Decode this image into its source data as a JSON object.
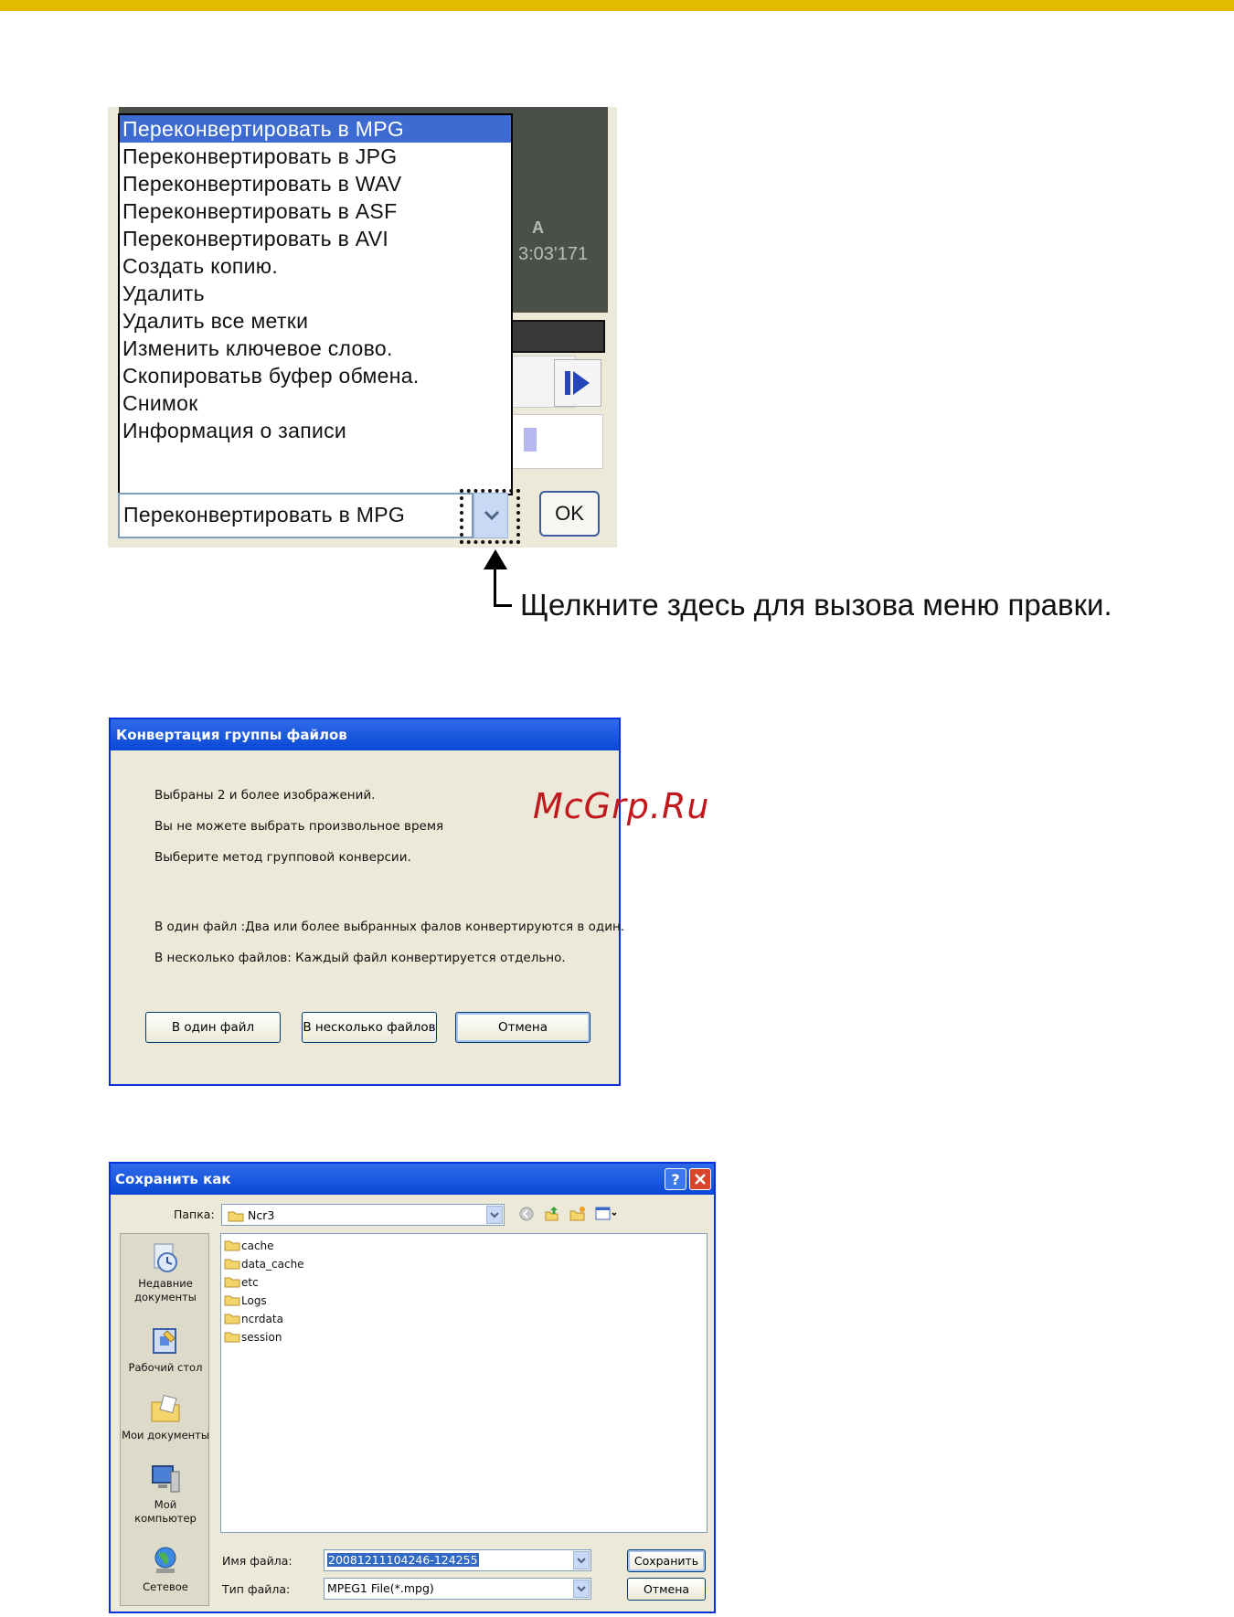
{
  "menu": {
    "items": [
      "Переконвертировать в MPG",
      "Переконвертировать в JPG",
      "Переконвертировать в WAV",
      "Переконвертировать в ASF",
      "Переконвертировать в AVI",
      "Создать копию.",
      "Удалить",
      "Удалить все метки",
      "Изменить ключевое слово.",
      "Скопироватьв буфер обмена.",
      "Снимок",
      "Информация о записи"
    ],
    "selected_index": 0,
    "combo_value": "Переконвертировать в MPG",
    "ok_label": "OK",
    "timecode": "3:03'171",
    "video_mark": "A"
  },
  "callout": {
    "text": "Щелкните здесь для вызова меню правки."
  },
  "group_dialog": {
    "title": "Конвертация группы файлов",
    "lines": [
      "Выбраны 2 и более изображений.",
      "Вы не можете выбрать произвольное время",
      "Выберите метод групповой конверсии.",
      "В один файл :Два или более выбранных фалов конвертируются в один.",
      "В несколько файлов: Каждый файл конвертируется отдельно."
    ],
    "buttons": {
      "single": "В один файл",
      "multiple": "В несколько файлов",
      "cancel": "Отмена"
    }
  },
  "watermark": "McGrp.Ru",
  "save_dialog": {
    "title": "Сохранить как",
    "help_label": "?",
    "folder_label": "Папка:",
    "folder_value": "Ncr3",
    "places": [
      {
        "label_1": "Недавние",
        "label_2": "документы",
        "icon": "recent-documents-icon"
      },
      {
        "label_1": "Рабочий стол",
        "label_2": "",
        "icon": "desktop-icon"
      },
      {
        "label_1": "Мои документы",
        "label_2": "",
        "icon": "my-documents-icon"
      },
      {
        "label_1": "Мой",
        "label_2": "компьютер",
        "icon": "my-computer-icon"
      },
      {
        "label_1": "Сетевое",
        "label_2": "",
        "icon": "network-icon"
      }
    ],
    "files": [
      "cache",
      "data_cache",
      "etc",
      "Logs",
      "ncrdata",
      "session"
    ],
    "filename_label": "Имя файла:",
    "filename_value": "20081211104246-124255",
    "filetype_label": "Тип файла:",
    "filetype_value": "MPEG1 File(*.mpg)",
    "save_label": "Сохранить",
    "cancel_label": "Отмена"
  },
  "colors": {
    "top_bar": "#e3bb00",
    "menu_highlight": "#3d6bd1",
    "xp_title_blue": "#0a48d6",
    "watermark_red": "#c0181c"
  }
}
